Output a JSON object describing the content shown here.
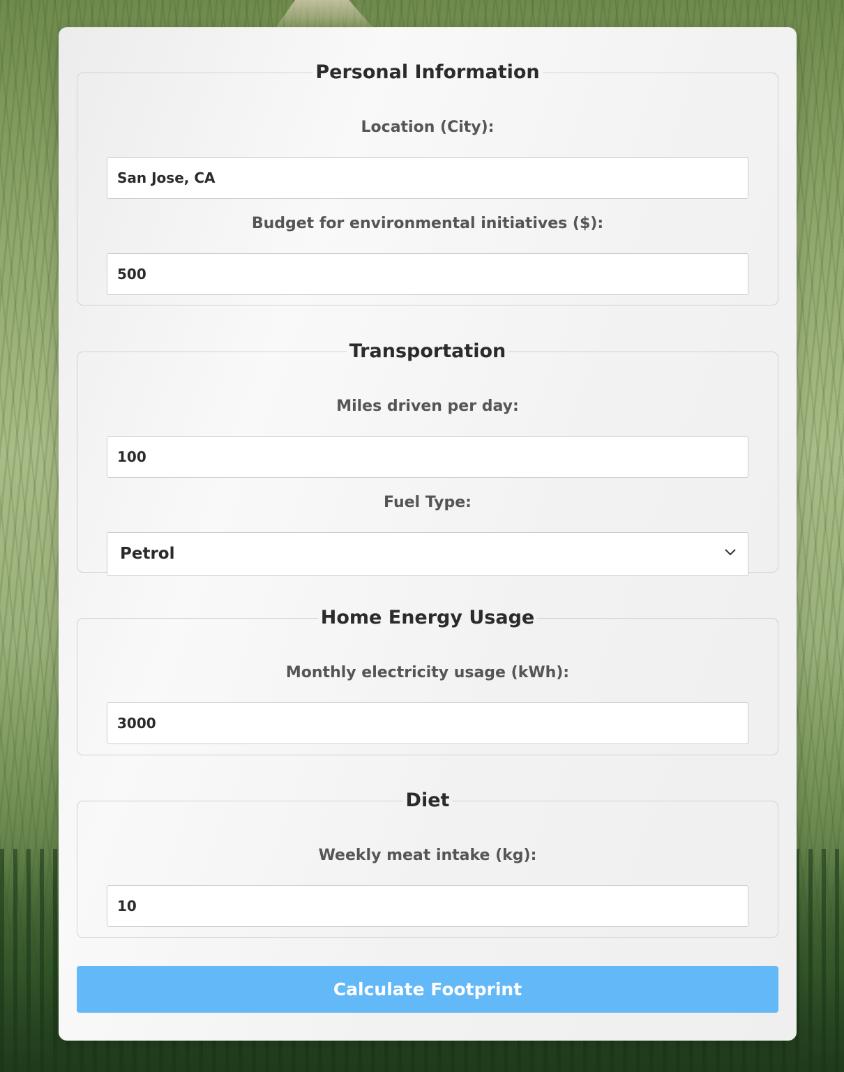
{
  "sections": {
    "personal": {
      "legend": "Personal Information",
      "location_label": "Location (City):",
      "location_value": "San Jose, CA",
      "budget_label": "Budget for environmental initiatives ($):",
      "budget_value": "500"
    },
    "transportation": {
      "legend": "Transportation",
      "miles_label": "Miles driven per day:",
      "miles_value": "100",
      "fuel_label": "Fuel Type:",
      "fuel_selected": "Petrol"
    },
    "energy": {
      "legend": "Home Energy Usage",
      "electricity_label": "Monthly electricity usage (kWh):",
      "electricity_value": "3000"
    },
    "diet": {
      "legend": "Diet",
      "meat_label": "Weekly meat intake (kg):",
      "meat_value": "10"
    }
  },
  "submit_label": "Calculate Footprint",
  "icons": {
    "fuel_dropdown": "chevron-down-icon"
  },
  "colors": {
    "button": "#63b8f7",
    "heading_text": "#2b2b2b",
    "label_text": "#555555"
  }
}
